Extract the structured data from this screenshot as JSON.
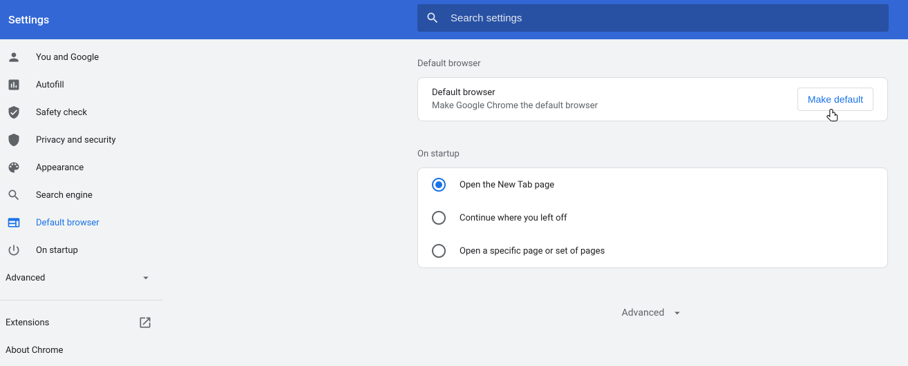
{
  "header": {
    "title": "Settings",
    "search_placeholder": "Search settings"
  },
  "sidebar": {
    "items": [
      {
        "label": "You and Google",
        "icon": "person"
      },
      {
        "label": "Autofill",
        "icon": "autofill"
      },
      {
        "label": "Safety check",
        "icon": "shield-check"
      },
      {
        "label": "Privacy and security",
        "icon": "shield"
      },
      {
        "label": "Appearance",
        "icon": "palette"
      },
      {
        "label": "Search engine",
        "icon": "search"
      },
      {
        "label": "Default browser",
        "icon": "browser",
        "selected": true
      },
      {
        "label": "On startup",
        "icon": "power"
      }
    ],
    "advanced": "Advanced",
    "extensions": "Extensions",
    "about": "About Chrome"
  },
  "main": {
    "default_browser_section": "Default browser",
    "default_browser_title": "Default browser",
    "default_browser_sub": "Make Google Chrome the default browser",
    "make_default": "Make default",
    "on_startup_section": "On startup",
    "startup_options": [
      {
        "label": "Open the New Tab page",
        "checked": true
      },
      {
        "label": "Continue where you left off",
        "checked": false
      },
      {
        "label": "Open a specific page or set of pages",
        "checked": false
      }
    ],
    "advanced": "Advanced"
  }
}
